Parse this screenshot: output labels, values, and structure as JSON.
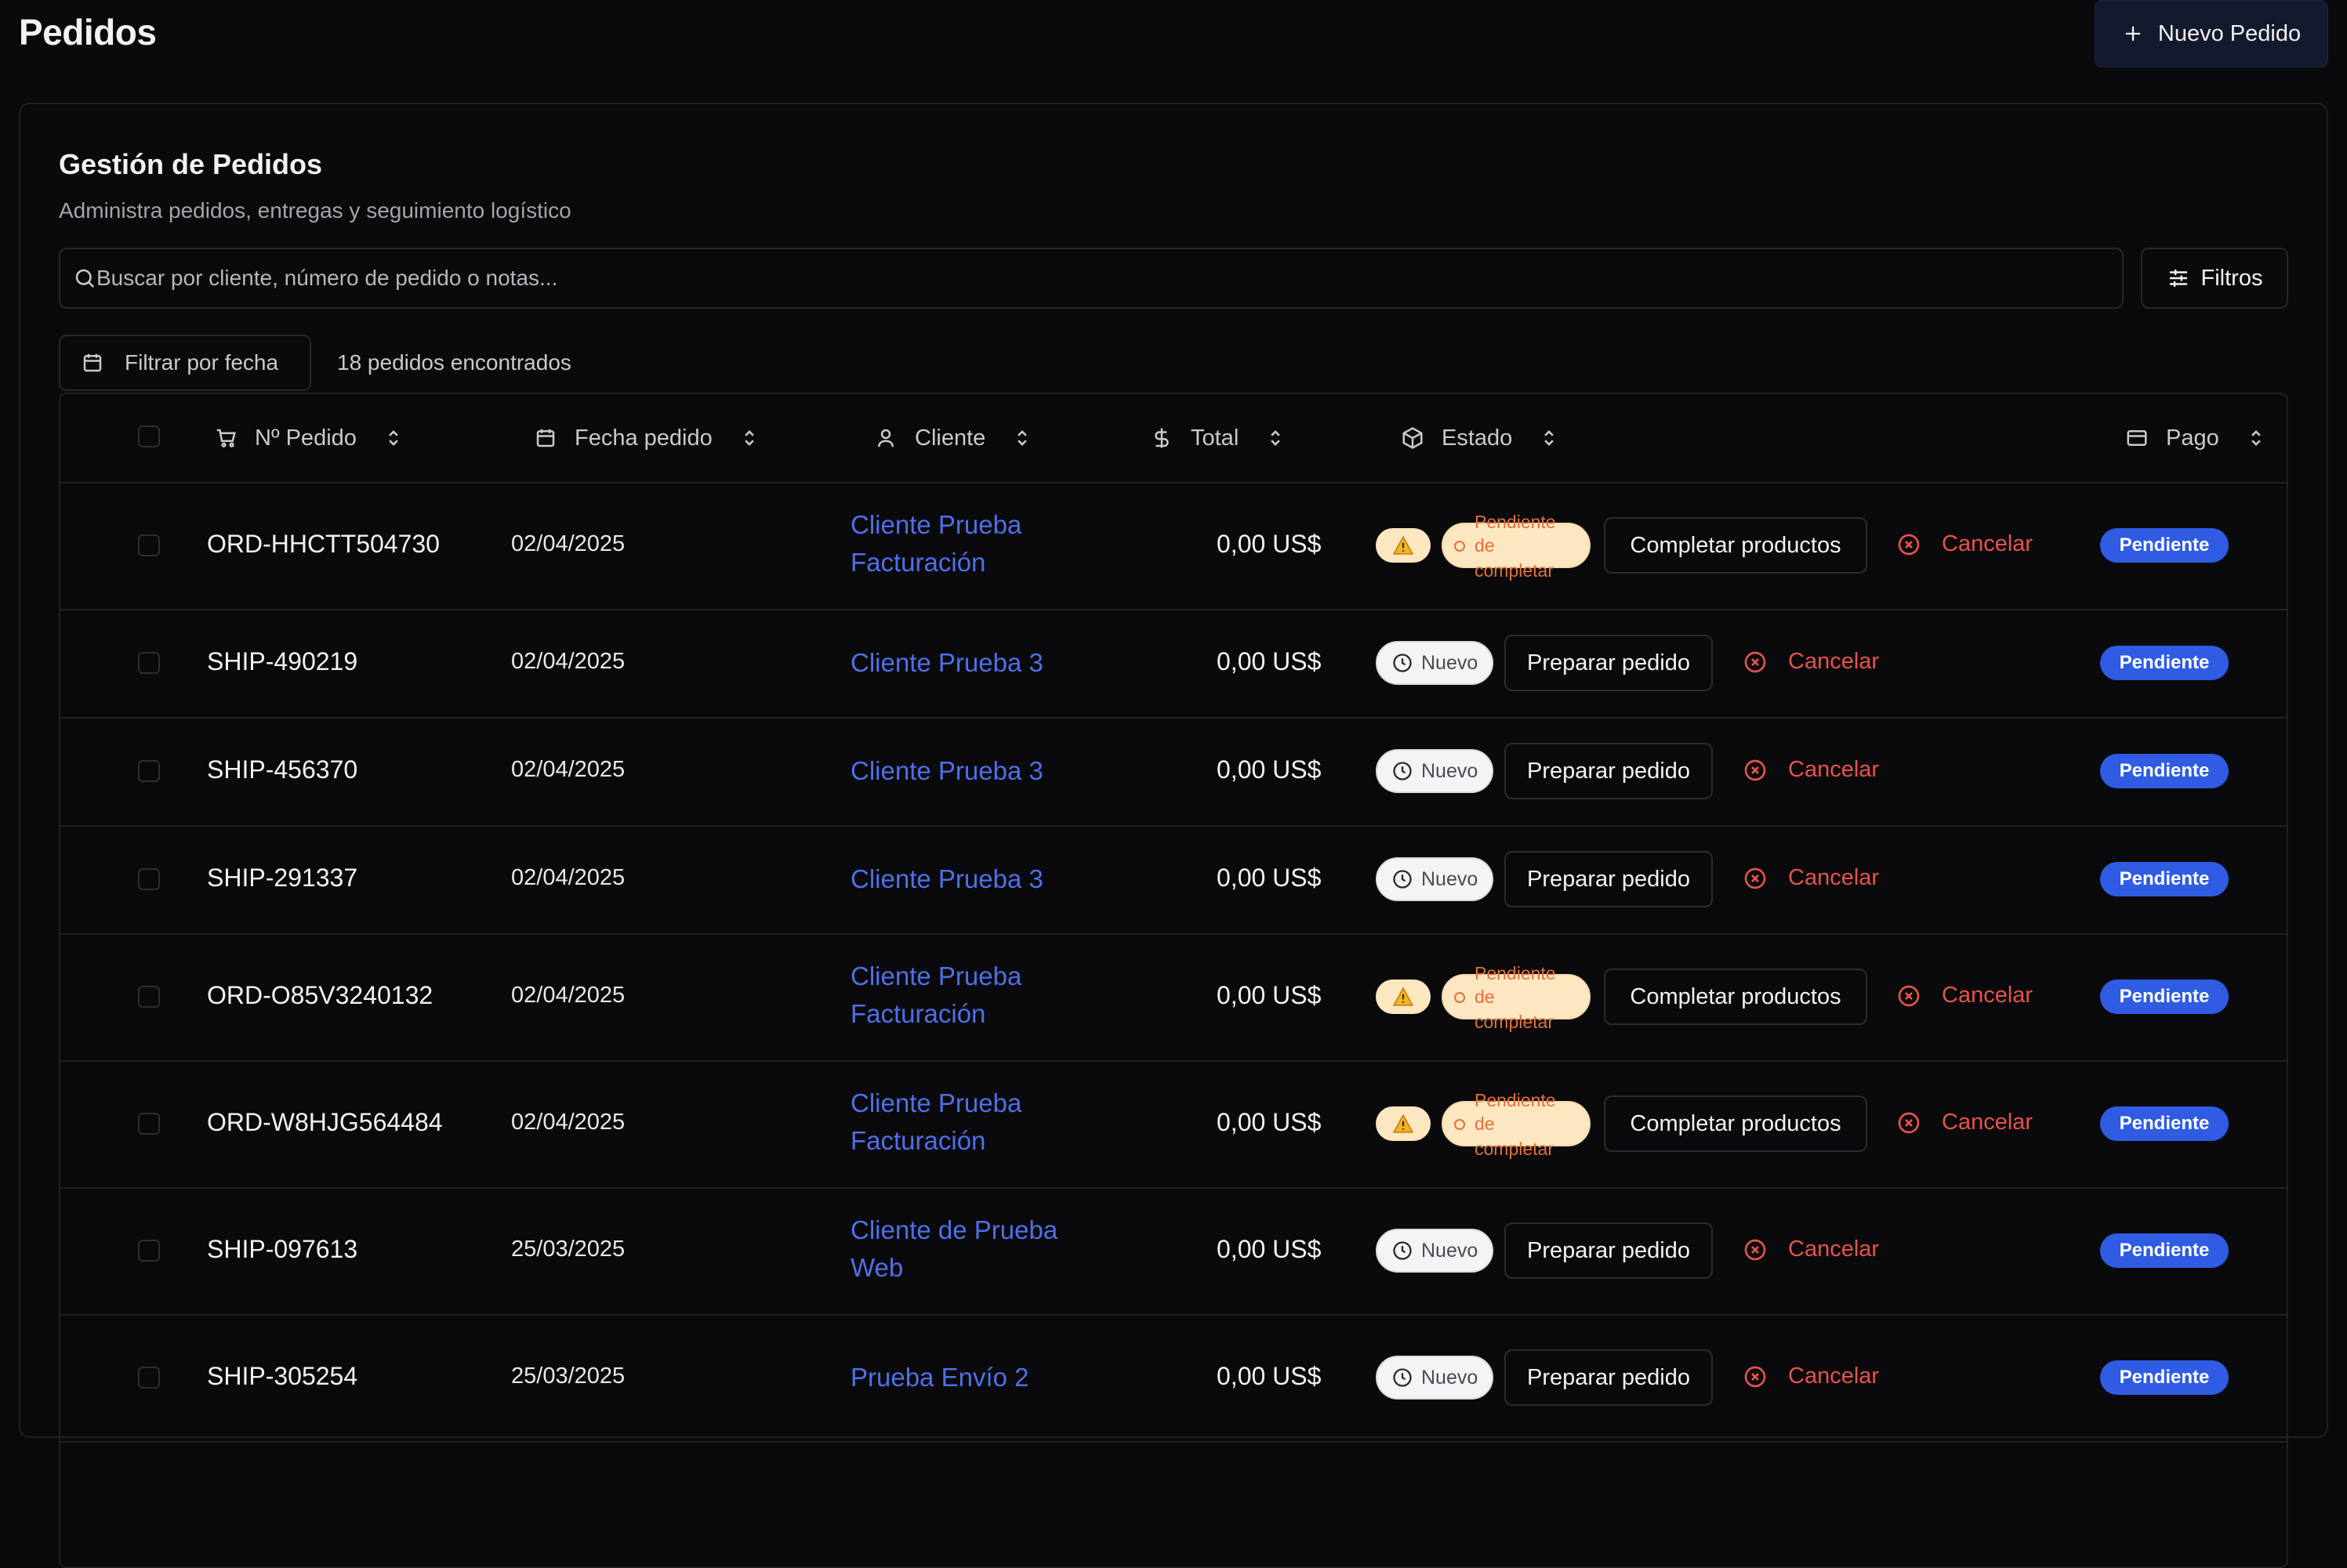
{
  "header": {
    "title": "Pedidos",
    "new_button": "Nuevo Pedido"
  },
  "card": {
    "title": "Gestión de Pedidos",
    "subtitle": "Administra pedidos, entregas y seguimiento logístico"
  },
  "search": {
    "placeholder": "Buscar por cliente, número de pedido o notas..."
  },
  "filters_button": "Filtros",
  "date_filter": "Filtrar por fecha",
  "result_count": "18 pedidos encontrados",
  "columns": {
    "order": "Nº Pedido",
    "date": "Fecha pedido",
    "client": "Cliente",
    "total": "Total",
    "status": "Estado",
    "payment": "Pago"
  },
  "status_labels": {
    "pending_l1": "Pendiente",
    "pending_l2": "de",
    "pending_l3": "completar",
    "new": "Nuevo"
  },
  "actions": {
    "complete": "Completar productos",
    "prepare": "Preparar pedido",
    "cancel": "Cancelar"
  },
  "colors": {
    "accent": "#2f5ce3",
    "link": "#4f6fe8",
    "danger": "#e5534b",
    "warning_bg": "#fde7c1"
  },
  "rows": [
    {
      "order": "ORD-HHCTT504730",
      "date": "02/04/2025",
      "client_l1": "Cliente Prueba",
      "client_l2": "Facturación",
      "total": "0,00 US$",
      "status": "pending",
      "payment": "Pendiente"
    },
    {
      "order": "SHIP-490219",
      "date": "02/04/2025",
      "client_l1": "Cliente Prueba 3",
      "client_l2": "",
      "total": "0,00 US$",
      "status": "new",
      "payment": "Pendiente"
    },
    {
      "order": "SHIP-456370",
      "date": "02/04/2025",
      "client_l1": "Cliente Prueba 3",
      "client_l2": "",
      "total": "0,00 US$",
      "status": "new",
      "payment": "Pendiente"
    },
    {
      "order": "SHIP-291337",
      "date": "02/04/2025",
      "client_l1": "Cliente Prueba 3",
      "client_l2": "",
      "total": "0,00 US$",
      "status": "new",
      "payment": "Pendiente"
    },
    {
      "order": "ORD-O85V3240132",
      "date": "02/04/2025",
      "client_l1": "Cliente Prueba",
      "client_l2": "Facturación",
      "total": "0,00 US$",
      "status": "pending",
      "payment": "Pendiente"
    },
    {
      "order": "ORD-W8HJG564484",
      "date": "02/04/2025",
      "client_l1": "Cliente Prueba",
      "client_l2": "Facturación",
      "total": "0,00 US$",
      "status": "pending",
      "payment": "Pendiente"
    },
    {
      "order": "SHIP-097613",
      "date": "25/03/2025",
      "client_l1": "Cliente de Prueba",
      "client_l2": "Web",
      "total": "0,00 US$",
      "status": "new",
      "payment": "Pendiente"
    },
    {
      "order": "SHIP-305254",
      "date": "25/03/2025",
      "client_l1": "Prueba Envío 2",
      "client_l2": "",
      "total": "0,00 US$",
      "status": "new",
      "payment": "Pendiente"
    }
  ]
}
